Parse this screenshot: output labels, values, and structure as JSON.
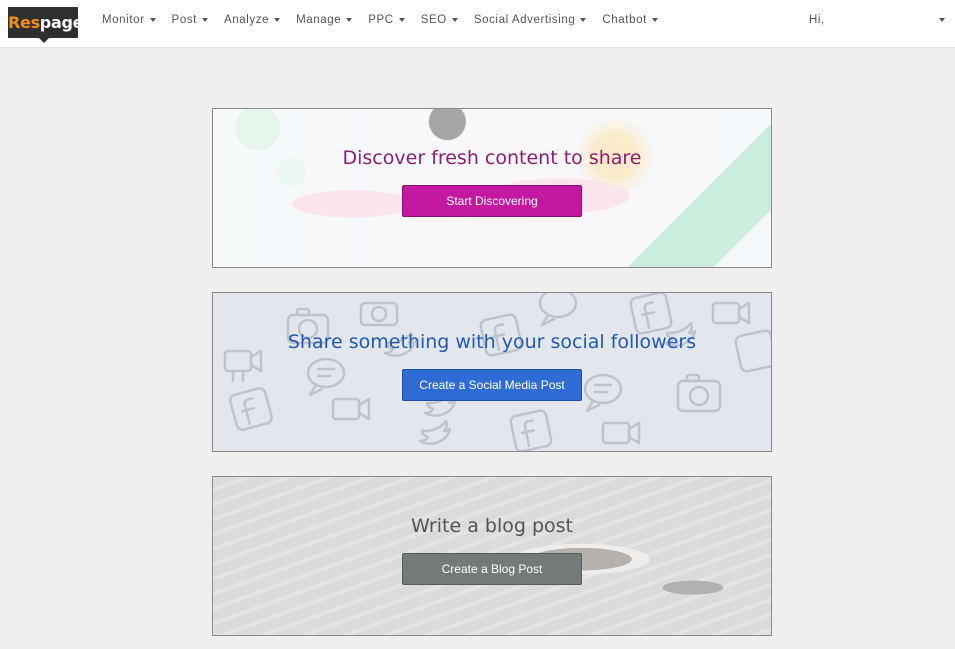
{
  "brand": {
    "logo_res": "Res",
    "logo_page": "page"
  },
  "nav": {
    "items": [
      {
        "label": "Monitor"
      },
      {
        "label": "Post"
      },
      {
        "label": "Analyze"
      },
      {
        "label": "Manage"
      },
      {
        "label": "PPC"
      },
      {
        "label": "SEO"
      },
      {
        "label": "Social Advertising"
      },
      {
        "label": "Chatbot"
      }
    ],
    "user_greeting": "Hi,"
  },
  "cards": {
    "discover": {
      "title": "Discover fresh content to share",
      "button": "Start Discovering"
    },
    "social": {
      "title": "Share something with your social followers",
      "button": "Create a Social Media Post"
    },
    "blog": {
      "title": "Write a blog post",
      "button": "Create a Blog Post"
    }
  },
  "colors": {
    "discover_title": "#8c1f72",
    "discover_button": "#c318a0",
    "social_title": "#1f5ab0",
    "social_button": "#2e6bd3",
    "blog_title": "#545454",
    "blog_button": "#737a79",
    "page_background": "#efefef"
  }
}
